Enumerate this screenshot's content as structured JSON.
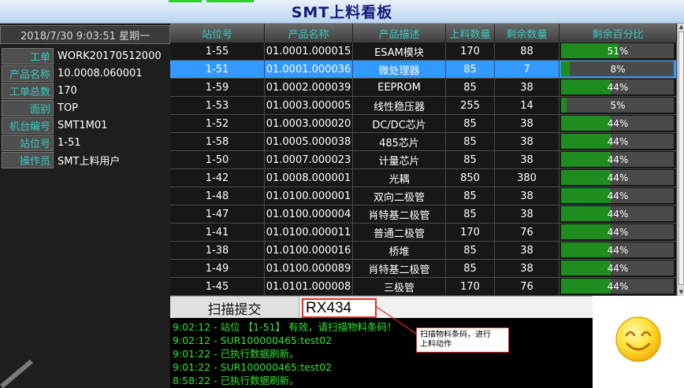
{
  "title": "SMT上料看板",
  "colors": {
    "accent_text": "#38c8c0",
    "selected_row": "#3399ff",
    "progress_fill": "#1e8c1e",
    "log_text": "#32e632",
    "callout_border": "#e0302a"
  },
  "datetime": "2018/7/30  9:03:51 星期一",
  "info": [
    {
      "label": "工单",
      "value": "WORK20170512000"
    },
    {
      "label": "产品名称",
      "value": "10.0008.060001"
    },
    {
      "label": "工单总数",
      "value": "170"
    },
    {
      "label": "面别",
      "value": "TOP"
    },
    {
      "label": "机台编号",
      "value": "SMT1M01"
    },
    {
      "label": "站位号",
      "value": "1-51"
    },
    {
      "label": "操作员",
      "value": "SMT上料用户"
    }
  ],
  "table": {
    "columns": [
      "站位号",
      "产品名称",
      "产品描述",
      "上料数量",
      "剩余数量",
      "剩余百分比"
    ],
    "rows": [
      {
        "station": "1-55",
        "product": "01.0001.000015",
        "desc": "ESAM模块",
        "loaded": "170",
        "remain": "88",
        "percent": "51%",
        "ratio": 0.51,
        "selected": false
      },
      {
        "station": "1-51",
        "product": "01.0001.000036",
        "desc": "微处理器",
        "loaded": "85",
        "remain": "7",
        "percent": "8%",
        "ratio": 0.08,
        "selected": true
      },
      {
        "station": "1-59",
        "product": "01.0002.000039",
        "desc": "EEPROM",
        "loaded": "85",
        "remain": "38",
        "percent": "44%",
        "ratio": 0.44,
        "selected": false
      },
      {
        "station": "1-53",
        "product": "01.0003.000005",
        "desc": "线性稳压器",
        "loaded": "255",
        "remain": "14",
        "percent": "5%",
        "ratio": 0.05,
        "selected": false
      },
      {
        "station": "1-52",
        "product": "01.0003.000020",
        "desc": "DC/DC芯片",
        "loaded": "85",
        "remain": "38",
        "percent": "44%",
        "ratio": 0.44,
        "selected": false
      },
      {
        "station": "1-58",
        "product": "01.0005.000038",
        "desc": "485芯片",
        "loaded": "85",
        "remain": "38",
        "percent": "44%",
        "ratio": 0.44,
        "selected": false
      },
      {
        "station": "1-50",
        "product": "01.0007.000023",
        "desc": "计量芯片",
        "loaded": "85",
        "remain": "38",
        "percent": "44%",
        "ratio": 0.44,
        "selected": false
      },
      {
        "station": "1-42",
        "product": "01.0008.000001",
        "desc": "光耦",
        "loaded": "850",
        "remain": "380",
        "percent": "44%",
        "ratio": 0.44,
        "selected": false
      },
      {
        "station": "1-48",
        "product": "01.0100.000001",
        "desc": "双向二极管",
        "loaded": "85",
        "remain": "38",
        "percent": "44%",
        "ratio": 0.44,
        "selected": false
      },
      {
        "station": "1-47",
        "product": "01.0100.000004",
        "desc": "肖特基二极管",
        "loaded": "85",
        "remain": "38",
        "percent": "44%",
        "ratio": 0.44,
        "selected": false
      },
      {
        "station": "1-41",
        "product": "01.0100.000011",
        "desc": "普通二极管",
        "loaded": "170",
        "remain": "76",
        "percent": "44%",
        "ratio": 0.44,
        "selected": false
      },
      {
        "station": "1-38",
        "product": "01.0100.000016",
        "desc": "桥堆",
        "loaded": "85",
        "remain": "38",
        "percent": "44%",
        "ratio": 0.44,
        "selected": false
      },
      {
        "station": "1-49",
        "product": "01.0100.000089",
        "desc": "肖特基二极管",
        "loaded": "85",
        "remain": "38",
        "percent": "44%",
        "ratio": 0.44,
        "selected": false
      },
      {
        "station": "1-45",
        "product": "01.0101.000008",
        "desc": "三极管",
        "loaded": "170",
        "remain": "76",
        "percent": "44%",
        "ratio": 0.44,
        "selected": false
      }
    ]
  },
  "scan": {
    "button_label": "扫描提交",
    "input_value": "RX434"
  },
  "log": [
    "9:02:12 - 站位 【1-51】 有效，请扫描物料条码！",
    "9:02:12 - SUR100000465:test02",
    "9:01:22 - 已执行数据刷新。",
    "9:01:22 - SUR100000465:test02",
    "8:58:22 - 已执行数据刷新。"
  ],
  "callout": {
    "line1": "扫描物料条码，进行",
    "line2": "上料动作"
  },
  "icons": {
    "status": "smiley-face-icon",
    "scroll_up": "arrow-up-icon",
    "scroll_down": "arrow-down-icon"
  }
}
